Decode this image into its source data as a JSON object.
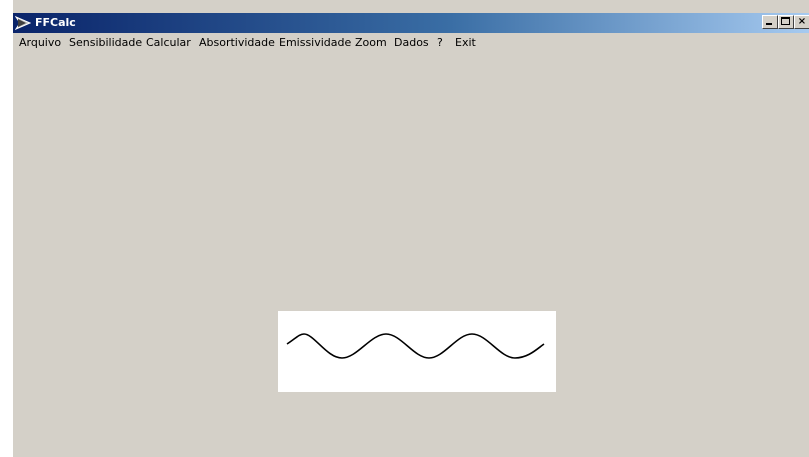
{
  "window": {
    "title": "FFCalc",
    "app_icon": "ffcalc-app-icon",
    "controls": {
      "minimize_icon": "minimize-icon",
      "maximize_icon": "maximize-icon",
      "close_icon": "close-icon",
      "close_label": "×"
    }
  },
  "menu": {
    "items": [
      {
        "label": "Arquivo"
      },
      {
        "label": "Sensibilidade"
      },
      {
        "label": "Calcular"
      },
      {
        "label": "Absortividade"
      },
      {
        "label": "Emissividade"
      },
      {
        "label": "Zoom"
      },
      {
        "label": "Dados"
      },
      {
        "label": "?"
      },
      {
        "label": "Exit"
      }
    ]
  },
  "canvas": {
    "content": "sine-wave-icon",
    "background": "#ffffff",
    "stroke": "#000000"
  },
  "colors": {
    "face": "#d4d0c8",
    "title_start": "#0a246a",
    "title_end": "#a6caf0"
  }
}
